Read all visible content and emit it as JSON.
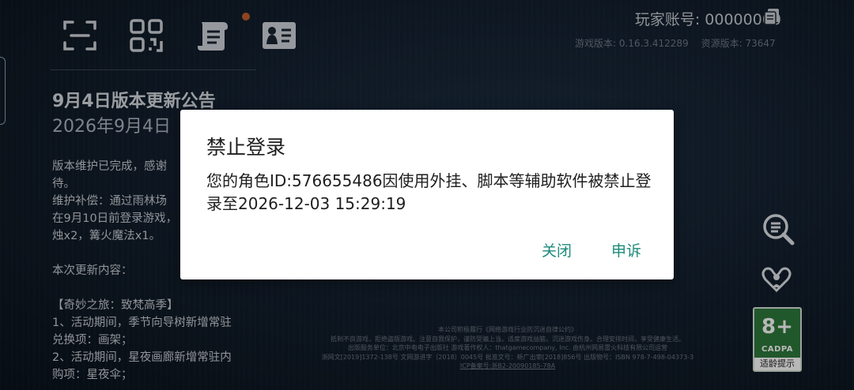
{
  "account": {
    "label": "玩家账号: 00000000"
  },
  "versions": {
    "game": "游戏版本: 0.16.3.412289",
    "resource": "资源版本: 73647"
  },
  "announcement": {
    "title": "9月4日版本更新公告",
    "date": "2026年9月4日",
    "body": "版本维护已完成，感谢\n待。\n维护补偿：通过雨林场\n在9月10日前登录游戏，\n烛x2，篝火魔法x1。\n\n本次更新内容：\n\n【奇妙之旅：致梵高季】\n1、活动期间，季节向导树新增常驻\n兑换项：画架；\n2、活动期间，星夜画廊新增常驻内\n购项：星夜伞；"
  },
  "icons": {
    "scan": "scan-icon",
    "qr": "qr-code-icon",
    "notice": "scroll-icon",
    "profile": "id-card-icon",
    "zoom": "magnifier-icon",
    "heart": "hands-heart-icon",
    "copy": "copy-icon"
  },
  "age_rating": {
    "number": "8+",
    "org": "CADPA",
    "tip": "适龄提示"
  },
  "footer": {
    "lines": [
      "本公司积极履行《网络游戏行业防沉迷自律公约》",
      "抵制不良游戏，拒绝盗版游戏。注意自我保护，谨防受骗上当。适度游戏益脑，沉迷游戏伤身。合理安排时间，享受健康生活。",
      "出版服务单位：北京中电电子出版社  游戏著作权人：thatgamecompany, Inc.  由杭州网易雷火科技有限公司运营",
      "浙网文[2019]1372-138号  文网游进字〔2018〕0045号  批准文号：新广出审[2018]856号  出版物号：ISBN 978-7-498-04373-3"
    ],
    "icp": "ICP备案号:浙B2-20090185-78A"
  },
  "dialog": {
    "title": "禁止登录",
    "message": "您的角色ID:576655486因使用外挂、脚本等辅助软件被禁止登录至2026-12-03 15:29:19",
    "close_label": "关闭",
    "appeal_label": "申诉"
  },
  "colors": {
    "accent": "#1d8a7b",
    "badge_green": "#2e7b3c",
    "notif": "#c25f2e"
  }
}
